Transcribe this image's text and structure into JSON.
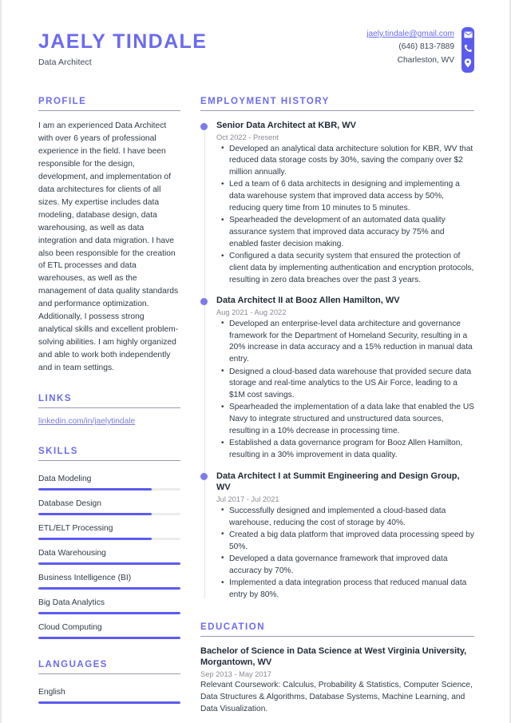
{
  "header": {
    "full_name": "JAELY TINDALE",
    "job_title": "Data Architect",
    "contact": {
      "email": "jaely.tindale@gmail.com",
      "phone": "(646) 813-7889",
      "location": "Charleston, WV",
      "icons": [
        "envelope-icon",
        "phone-icon",
        "location-pin-icon"
      ]
    }
  },
  "colors": {
    "accent": "#6b6bf0",
    "accent_bar": "#5b5bef",
    "dot": "#7b7bea",
    "text": "#2e3a47",
    "muted": "#8a8a95",
    "rule": "#9a9ab0",
    "track": "#ececed"
  },
  "sidebar": {
    "profile": {
      "title": "Profile",
      "text": "I am an experienced Data Architect with over 6 years of professional experience in the field. I have been responsible for the design, development, and implementation of data architectures for clients of all sizes. My expertise includes data modeling, database design, data warehousing, as well as data integration and data migration. I have also been responsible for the creation of ETL processes and data warehouses, as well as the management of data quality standards and performance optimization. Additionally, I possess strong analytical skills and excellent problem-solving abilities. I am highly organized and able to work both independently and in team settings."
    },
    "links": {
      "title": "Links",
      "items": [
        {
          "label": "linkedin.com/in/jaelytindale"
        }
      ]
    },
    "skills": {
      "title": "Skills",
      "items": [
        {
          "name": "Data Modeling",
          "level": 80
        },
        {
          "name": "Database Design",
          "level": 80
        },
        {
          "name": "ETL/ELT Processing",
          "level": 80
        },
        {
          "name": "Data Warehousing",
          "level": 100
        },
        {
          "name": "Business Intelligence (BI)",
          "level": 100
        },
        {
          "name": "Big Data Analytics",
          "level": 100
        },
        {
          "name": "Cloud Computing",
          "level": 100
        }
      ]
    },
    "languages": {
      "title": "Languages",
      "items": [
        {
          "name": "English",
          "level": 100
        }
      ]
    }
  },
  "main": {
    "employment": {
      "title": "Employment History",
      "jobs": [
        {
          "heading": "Senior Data Architect at KBR, WV",
          "dates": "Oct 2022 - Present",
          "bullets": [
            "Developed an analytical data architecture solution for KBR, WV that reduced data storage costs by 30%, saving the company over $2 million annually.",
            "Led a team of 6 data architects in designing and implementing a data warehouse system that improved data access by 50%, reducing query time from 10 minutes to 5 minutes.",
            "Spearheaded the development of an automated data quality assurance system that improved data accuracy by 75% and enabled faster decision making.",
            "Configured a data security system that ensured the protection of client data by implementing authentication and encryption protocols, resulting in zero data breaches over the past 3 years."
          ]
        },
        {
          "heading": "Data Architect II at Booz Allen Hamilton, WV",
          "dates": "Aug 2021 - Aug 2022",
          "bullets": [
            "Developed an enterprise-level data architecture and governance framework for the Department of Homeland Security, resulting in a 20% increase in data accuracy and a 15% reduction in manual data entry.",
            "Designed a cloud-based data warehouse that provided secure data storage and real-time analytics to the US Air Force, leading to a $1M cost savings.",
            "Spearheaded the implementation of a data lake that enabled the US Navy to integrate structured and unstructured data sources, resulting in a 10% decrease in processing time.",
            "Established a data governance program for Booz Allen Hamilton, resulting in a 30% improvement in data quality."
          ]
        },
        {
          "heading": "Data Architect I at Summit Engineering and Design Group, WV",
          "dates": "Jul 2017 - Jul 2021",
          "bullets": [
            "Successfully designed and implemented a cloud-based data warehouse, reducing the cost of storage by 40%.",
            "Created a big data platform that improved data processing speed by 50%.",
            "Developed a data governance framework that improved data accuracy by 70%.",
            "Implemented a data integration process that reduced manual data entry by 80%."
          ]
        }
      ]
    },
    "education": {
      "title": "Education",
      "entries": [
        {
          "heading": "Bachelor of Science in Data Science at West Virginia University, Morgantown, WV",
          "dates": "Sep 2013 - May 2017",
          "description": "Relevant Coursework: Calculus, Probability & Statistics, Computer Science, Data Structures & Algorithms, Database Systems, Machine Learning, and Data Visualization."
        }
      ]
    }
  }
}
